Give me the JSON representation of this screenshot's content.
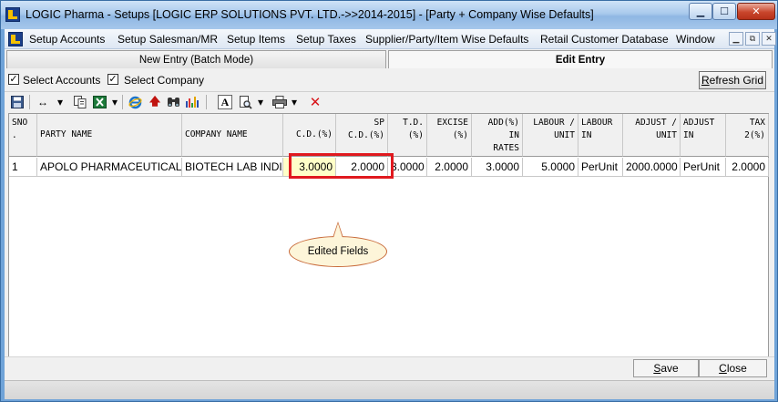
{
  "window": {
    "title": "LOGIC Pharma - Setups  [LOGIC ERP SOLUTIONS PVT. LTD.->>2014-2015] - [Party + Company Wise Defaults]",
    "min_glyph": "▁",
    "max_glyph": "☐",
    "close_glyph": "✕"
  },
  "menubar": {
    "items": [
      "Setup Accounts",
      "Setup Salesman/MR",
      "Setup Items",
      "Setup Taxes",
      "Supplier/Party/Item Wise Defaults",
      "Retail Customer Database",
      "Window"
    ],
    "mdi_min": "▁",
    "mdi_restore": "⧉",
    "mdi_close": "✕"
  },
  "tabs": {
    "new_entry": "New Entry (Batch Mode)",
    "edit_entry": "Edit Entry",
    "active": "Edit Entry"
  },
  "options": {
    "select_accounts": "Select Accounts",
    "select_company": "Select Company",
    "select_accounts_checked": true,
    "select_company_checked": true,
    "check_glyph": "✓",
    "refresh_prefix": "R",
    "refresh_rest": "efresh Grid"
  },
  "toolbar": {
    "icons": [
      "save-grid-icon",
      "resize-columns-icon",
      "copy-icon",
      "excel-icon",
      "internet-explorer-icon",
      "up-arrow-icon",
      "binoculars-icon",
      "chart-icon",
      "font-icon",
      "print-preview-icon",
      "printer-icon",
      "delete-icon"
    ],
    "glyphs": {
      "resize": "↔",
      "dropdown": "▾",
      "up": "🡅",
      "find": "⚲",
      "font": "A",
      "delete": "✕"
    }
  },
  "grid": {
    "headers": [
      "SNO\n.",
      "PARTY NAME",
      "COMPANY NAME",
      "C.D.(%)",
      "SP\nC.D.(%)",
      "T.D.\n(%)",
      "EXCISE\n(%)",
      "ADD(%)\nIN\nRATES",
      "LABOUR /\nUNIT",
      "LABOUR\nIN",
      "ADJUST /\nUNIT",
      "ADJUST\nIN",
      "TAX\n2(%)"
    ],
    "rows": [
      [
        "1",
        "APOLO PHARMACEUTICALS",
        "BIOTECH LAB INDIA",
        "3.0000",
        "2.0000",
        "3.0000",
        "2.0000",
        "3.0000",
        "5.0000",
        "PerUnit",
        "2000.0000",
        "PerUnit",
        "2.0000"
      ]
    ]
  },
  "annotation": {
    "callout": "Edited Fields",
    "highlight_color": "#e0191f"
  },
  "buttons": {
    "save_prefix": "S",
    "save_rest": "ave",
    "close_prefix": "C",
    "close_rest": "lose"
  }
}
